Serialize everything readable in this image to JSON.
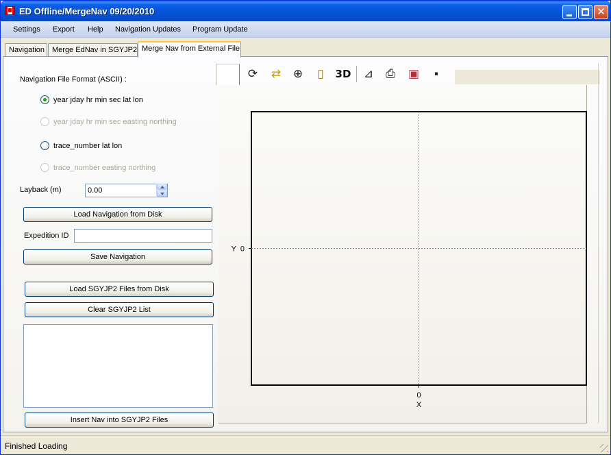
{
  "window": {
    "title": "ED Offline/MergeNav 09/20/2010",
    "controls": {
      "minimize": "minimize",
      "maximize": "maximize",
      "close": "✕"
    }
  },
  "menu": [
    "Settings",
    "Export",
    "Help",
    "Navigation Updates",
    "Program Update"
  ],
  "tabs": [
    {
      "label": "Navigation",
      "active": false
    },
    {
      "label": "Merge EdNav in SGYJP2",
      "active": false
    },
    {
      "label": "Merge Nav from External File",
      "active": true
    }
  ],
  "form": {
    "format_label": "Navigation File Format (ASCII) :",
    "formats": [
      {
        "label": "year jday hr min sec lat lon",
        "selected": true,
        "enabled": true
      },
      {
        "label": "year jday hr min sec easting northing",
        "selected": false,
        "enabled": false
      },
      {
        "label": "trace_number lat lon",
        "selected": false,
        "enabled": true
      },
      {
        "label": "trace_number easting northing",
        "selected": false,
        "enabled": false
      }
    ],
    "layback_label": "Layback (m)",
    "layback_value": "0.00",
    "load_nav_button": "Load Navigation from Disk",
    "expedition_label": "Expedition ID",
    "expedition_value": "",
    "save_nav_button": "Save Navigation",
    "load_sgy_button": "Load SGYJP2 Files from Disk",
    "clear_sgy_button": "Clear SGYJP2 List",
    "sgy_files": [],
    "insert_nav_button": "Insert Nav into SGYJP2 Files"
  },
  "toolbar": {
    "tools": [
      {
        "name": "rotate",
        "icon": "rotate-icon"
      },
      {
        "name": "pan",
        "icon": "pan-arrows-icon"
      },
      {
        "name": "zoom",
        "icon": "zoom-in-icon"
      },
      {
        "name": "page",
        "icon": "page-icon"
      },
      {
        "name": "3d",
        "label": "3D"
      },
      {
        "name": "axes",
        "icon": "axes-edit-icon"
      },
      {
        "name": "print",
        "icon": "printer-icon"
      },
      {
        "name": "export-image",
        "icon": "export-image-icon"
      },
      {
        "name": "save",
        "icon": "floppy-disk-icon"
      }
    ]
  },
  "chart_data": {
    "type": "scatter",
    "series": [],
    "xlabel": "X",
    "ylabel": "Y",
    "x_ticks": [
      "0"
    ],
    "y_ticks": [
      "0"
    ],
    "xlim": [
      -1,
      1
    ],
    "ylim": [
      -1,
      1
    ],
    "grid": "dashed crosshair at origin"
  },
  "status": {
    "text": "Finished Loading"
  }
}
